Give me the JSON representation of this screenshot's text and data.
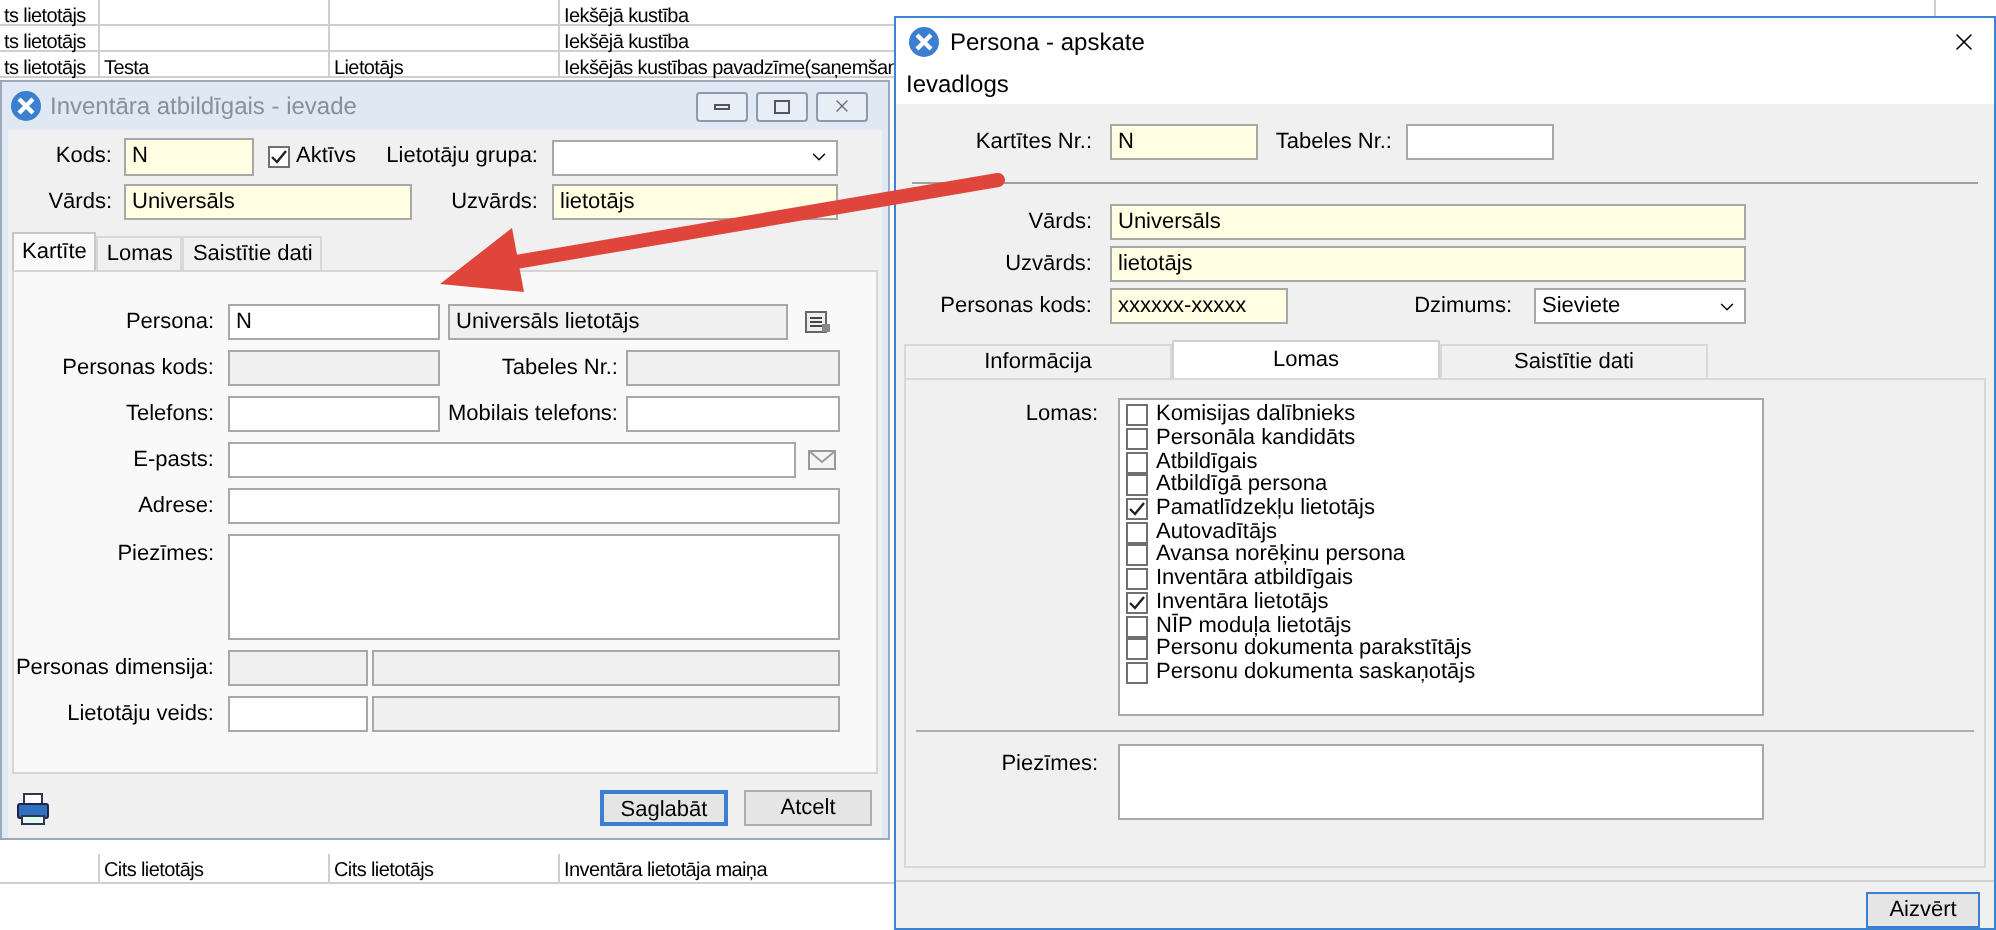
{
  "background_table": {
    "top_rows": [
      {
        "column_1": "ts lietotājs",
        "column_4": "Iekšējā kustība"
      },
      {
        "column_1": "ts lietotājs",
        "column_4": "Iekšējā kustība"
      },
      {
        "column_1": "ts lietotājs",
        "column_2": "Testa",
        "column_3": "Lietotājs",
        "column_4": "Iekšējās kustības pavadzīme(saņemšan"
      }
    ],
    "bottom_rows": [
      {
        "column_2": "Cits lietotājs",
        "column_3": "Cits lietotājs",
        "column_4": "Inventāra lietotāja maiņa"
      }
    ]
  },
  "entry_window": {
    "title": "Inventāra atbildīgais - ievade",
    "focused": false,
    "code": {
      "label": "Kods:",
      "value": "N",
      "required": true
    },
    "active_checkbox": {
      "label": "Aktīvs",
      "checked": true
    },
    "user_group": {
      "label": "Lietotāju grupa:"
    },
    "first_name": {
      "label": "Vārds:",
      "value": "Universāls",
      "required": true
    },
    "last_name": {
      "label": "Uzvārds:",
      "value": "lietotājs",
      "required": true
    },
    "tabs": [
      {
        "label": "Kartīte",
        "selected": true
      },
      {
        "label": "Lomas",
        "selected": false
      },
      {
        "label": "Saistītie dati",
        "selected": false
      }
    ],
    "card": {
      "person": {
        "label": "Persona:",
        "value": "N",
        "name": "Universāls lietotājs"
      },
      "personal_code": {
        "label": "Personas kods:",
        "disabled": true
      },
      "employee_no": {
        "label": "Tabeles Nr.:",
        "disabled": true
      },
      "phone": {
        "label": "Telefons:",
        "disabled": false
      },
      "mobile": {
        "label": "Mobilais telefons:",
        "disabled": false
      },
      "email": {
        "label": "E-pasts:",
        "disabled": false
      },
      "address": {
        "label": "Adrese:",
        "disabled": false
      },
      "notes": {
        "label": "Piezīmes:",
        "disabled": false
      },
      "dimension": {
        "label": "Personas dimensija:",
        "disabled": true
      },
      "user_type": {
        "label": "Lietotāju veids:",
        "disabled": false
      }
    },
    "buttons": [
      {
        "label": "Saglabāt",
        "default": true
      },
      {
        "label": "Atcelt",
        "default": false
      }
    ]
  },
  "view_window": {
    "title": "Persona - apskate",
    "focused": true,
    "menu": [
      "Ievadlogs"
    ],
    "card_no": {
      "label": "Kartītes Nr.:",
      "value": "N",
      "required": true
    },
    "employee_no": {
      "label": "Tabeles Nr.:",
      "required": false
    },
    "first_name": {
      "label": "Vārds:",
      "value": "Universāls",
      "required": true
    },
    "last_name": {
      "label": "Uzvārds:",
      "value": "lietotājs",
      "required": true
    },
    "personal_code": {
      "label": "Personas kods:",
      "value": "xxxxxx-xxxxx",
      "required": true
    },
    "gender": {
      "label": "Dzimums:",
      "value": "Sieviete"
    },
    "tabs": [
      {
        "label": "Informācija",
        "selected": false
      },
      {
        "label": "Lomas",
        "selected": true
      },
      {
        "label": "Saistītie dati",
        "selected": false
      }
    ],
    "roles": {
      "label": "Lomas:",
      "items": [
        {
          "label": "Komisijas dalībnieks",
          "checked": false
        },
        {
          "label": "Personāla kandidāts",
          "checked": false
        },
        {
          "label": "Atbildīgais",
          "checked": false
        },
        {
          "label": "Atbildīgā persona",
          "checked": false
        },
        {
          "label": "Pamatlīdzekļu lietotājs",
          "checked": true
        },
        {
          "label": "Autovadītājs",
          "checked": false
        },
        {
          "label": "Avansa norēķinu persona",
          "checked": false
        },
        {
          "label": "Inventāra atbildīgais",
          "checked": false
        },
        {
          "label": "Inventāra lietotājs",
          "checked": true
        },
        {
          "label": "NĪP moduļa lietotājs",
          "checked": false
        },
        {
          "label": "Personu dokumenta parakstītājs",
          "checked": false
        },
        {
          "label": "Personu dokumenta saskaņotājs",
          "checked": false
        }
      ]
    },
    "notes": {
      "label": "Piezīmes:"
    },
    "close_button": "Aizvērt"
  }
}
